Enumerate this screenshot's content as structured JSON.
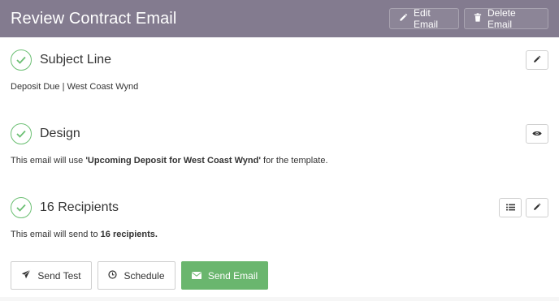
{
  "header": {
    "title": "Review Contract Email",
    "edit_label": "Edit Email",
    "delete_label": "Delete Email",
    "background": "#837b8f"
  },
  "sections": {
    "subject": {
      "title": "Subject Line",
      "value": "Deposit Due | West Coast Wynd"
    },
    "design": {
      "title": "Design",
      "text_before": "This email will use ",
      "template_name": "'Upcoming Deposit for West Coast Wynd'",
      "text_after": " for the template."
    },
    "recipients": {
      "title": "16 Recipients",
      "text_before": "This email will send to ",
      "count_text": "16 recipients."
    }
  },
  "actions": {
    "send_test_label": "Send Test",
    "schedule_label": "Schedule",
    "send_email_label": "Send Email"
  },
  "colors": {
    "check": "#6bbf73",
    "send_button": "#6ab66e"
  },
  "icons": [
    "pencil-icon",
    "trash-icon",
    "check-icon",
    "eye-icon",
    "list-icon",
    "paper-plane-icon",
    "clock-icon",
    "envelope-icon"
  ]
}
